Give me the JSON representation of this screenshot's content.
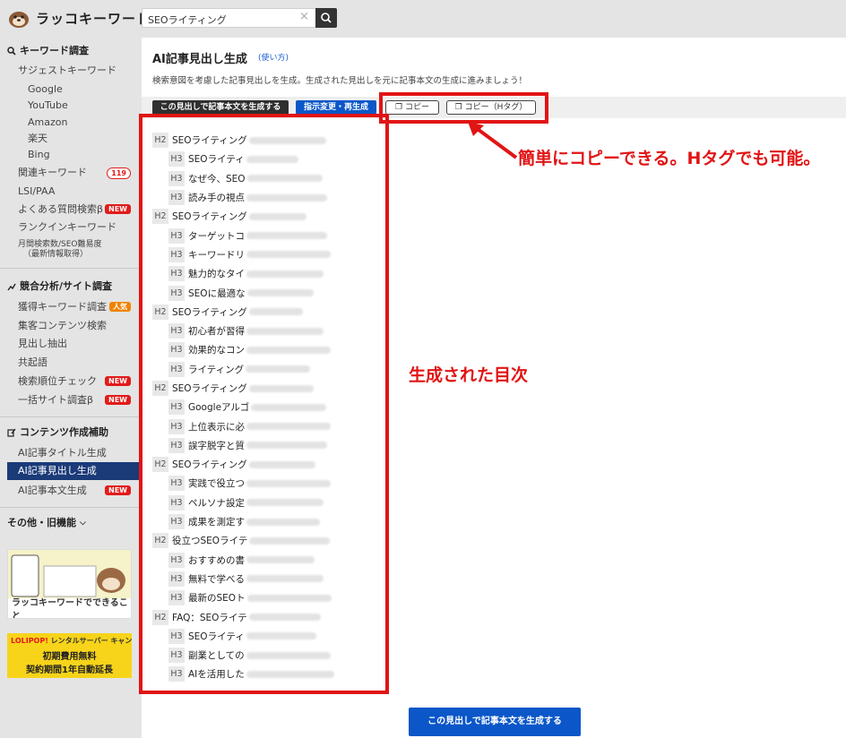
{
  "header": {
    "logo_text": "ラッコキーワード",
    "search_value": "SEOライティング"
  },
  "sidebar": {
    "sections": {
      "keyword": "キーワード調査",
      "competitor": "競合分析/サイト調査",
      "content": "コンテンツ作成補助",
      "other": "その他・旧機能"
    },
    "keyword_items": {
      "suggest": "サジェストキーワード",
      "google": "Google",
      "youtube": "YouTube",
      "amazon": "Amazon",
      "rakuten": "楽天",
      "bing": "Bing",
      "related": "関連キーワード",
      "related_count": "119",
      "lsi": "LSI/PAA",
      "faq": "よくある質問検索β",
      "rankin": "ランクインキーワード",
      "volume_line1": "月間検索数/SEO難易度",
      "volume_line2": "（最新情報取得）"
    },
    "competitor_items": {
      "acquired": "獲得キーワード調査",
      "collect": "集客コンテンツ検索",
      "headings": "見出し抽出",
      "cooccur": "共起語",
      "rankcheck": "検索順位チェック",
      "bulk": "一括サイト調査β"
    },
    "content_items": {
      "title_gen": "AI記事タイトル生成",
      "heading_gen": "AI記事見出し生成",
      "body_gen": "AI記事本文生成"
    },
    "badge_new": "NEW",
    "badge_popular": "人気",
    "banner1_text": "ラッコキーワードでできること",
    "banner2_brand": "LOLIPOP!",
    "banner2_sub": "レンタルサーバー",
    "banner2_campaign": "キャンペーン中!",
    "banner2_line1": "初期費用無料",
    "banner2_line2": "契約期間1年自動延長"
  },
  "main": {
    "title": "AI記事見出し生成",
    "usage_link": "(使い方)",
    "description": "検索意図を考慮した記事見出しを生成。生成された見出しを元に記事本文の生成に進みましょう！",
    "buttons": {
      "generate_body": "この見出しで記事本文を生成する",
      "regenerate": "指示変更・再生成",
      "copy": "コピー",
      "copy_htag": "コピー（Hタグ）",
      "bottom_generate": "この見出しで記事本文を生成する"
    },
    "toc": [
      {
        "level": "H2",
        "text": "SEOライティング"
      },
      {
        "level": "H3",
        "text": "SEOライティ"
      },
      {
        "level": "H3",
        "text": "なぜ今、SEO"
      },
      {
        "level": "H3",
        "text": "読み手の視点"
      },
      {
        "level": "H2",
        "text": "SEOライティング"
      },
      {
        "level": "H3",
        "text": "ターゲットコ"
      },
      {
        "level": "H3",
        "text": "キーワードリ"
      },
      {
        "level": "H3",
        "text": "魅力的なタイ"
      },
      {
        "level": "H3",
        "text": "SEOに最適な"
      },
      {
        "level": "H2",
        "text": "SEOライティング"
      },
      {
        "level": "H3",
        "text": "初心者が習得"
      },
      {
        "level": "H3",
        "text": "効果的なコン"
      },
      {
        "level": "H3",
        "text": "ライティング"
      },
      {
        "level": "H2",
        "text": "SEOライティング"
      },
      {
        "level": "H3",
        "text": "Googleアルゴ"
      },
      {
        "level": "H3",
        "text": "上位表示に必"
      },
      {
        "level": "H3",
        "text": "誤字脱字と質"
      },
      {
        "level": "H2",
        "text": "SEOライティング"
      },
      {
        "level": "H3",
        "text": "実践で役立つ"
      },
      {
        "level": "H3",
        "text": "ペルソナ設定"
      },
      {
        "level": "H3",
        "text": "成果を測定す"
      },
      {
        "level": "H2",
        "text": "役立つSEOライテ"
      },
      {
        "level": "H3",
        "text": "おすすめの書"
      },
      {
        "level": "H3",
        "text": "無料で学べる"
      },
      {
        "level": "H3",
        "text": "最新のSEOト"
      },
      {
        "level": "H2",
        "text": "FAQ：SEOライテ"
      },
      {
        "level": "H3",
        "text": "SEOライティ"
      },
      {
        "level": "H3",
        "text": "副業としての"
      },
      {
        "level": "H3",
        "text": "AIを活用した"
      }
    ]
  },
  "annotations": {
    "copy_note": "簡単にコピーできる。Hタグでも可能。",
    "toc_note": "生成された目次"
  },
  "colors": {
    "accent_red": "#e11414",
    "primary_blue": "#0b57c9",
    "nav_active": "#1a3a78"
  }
}
